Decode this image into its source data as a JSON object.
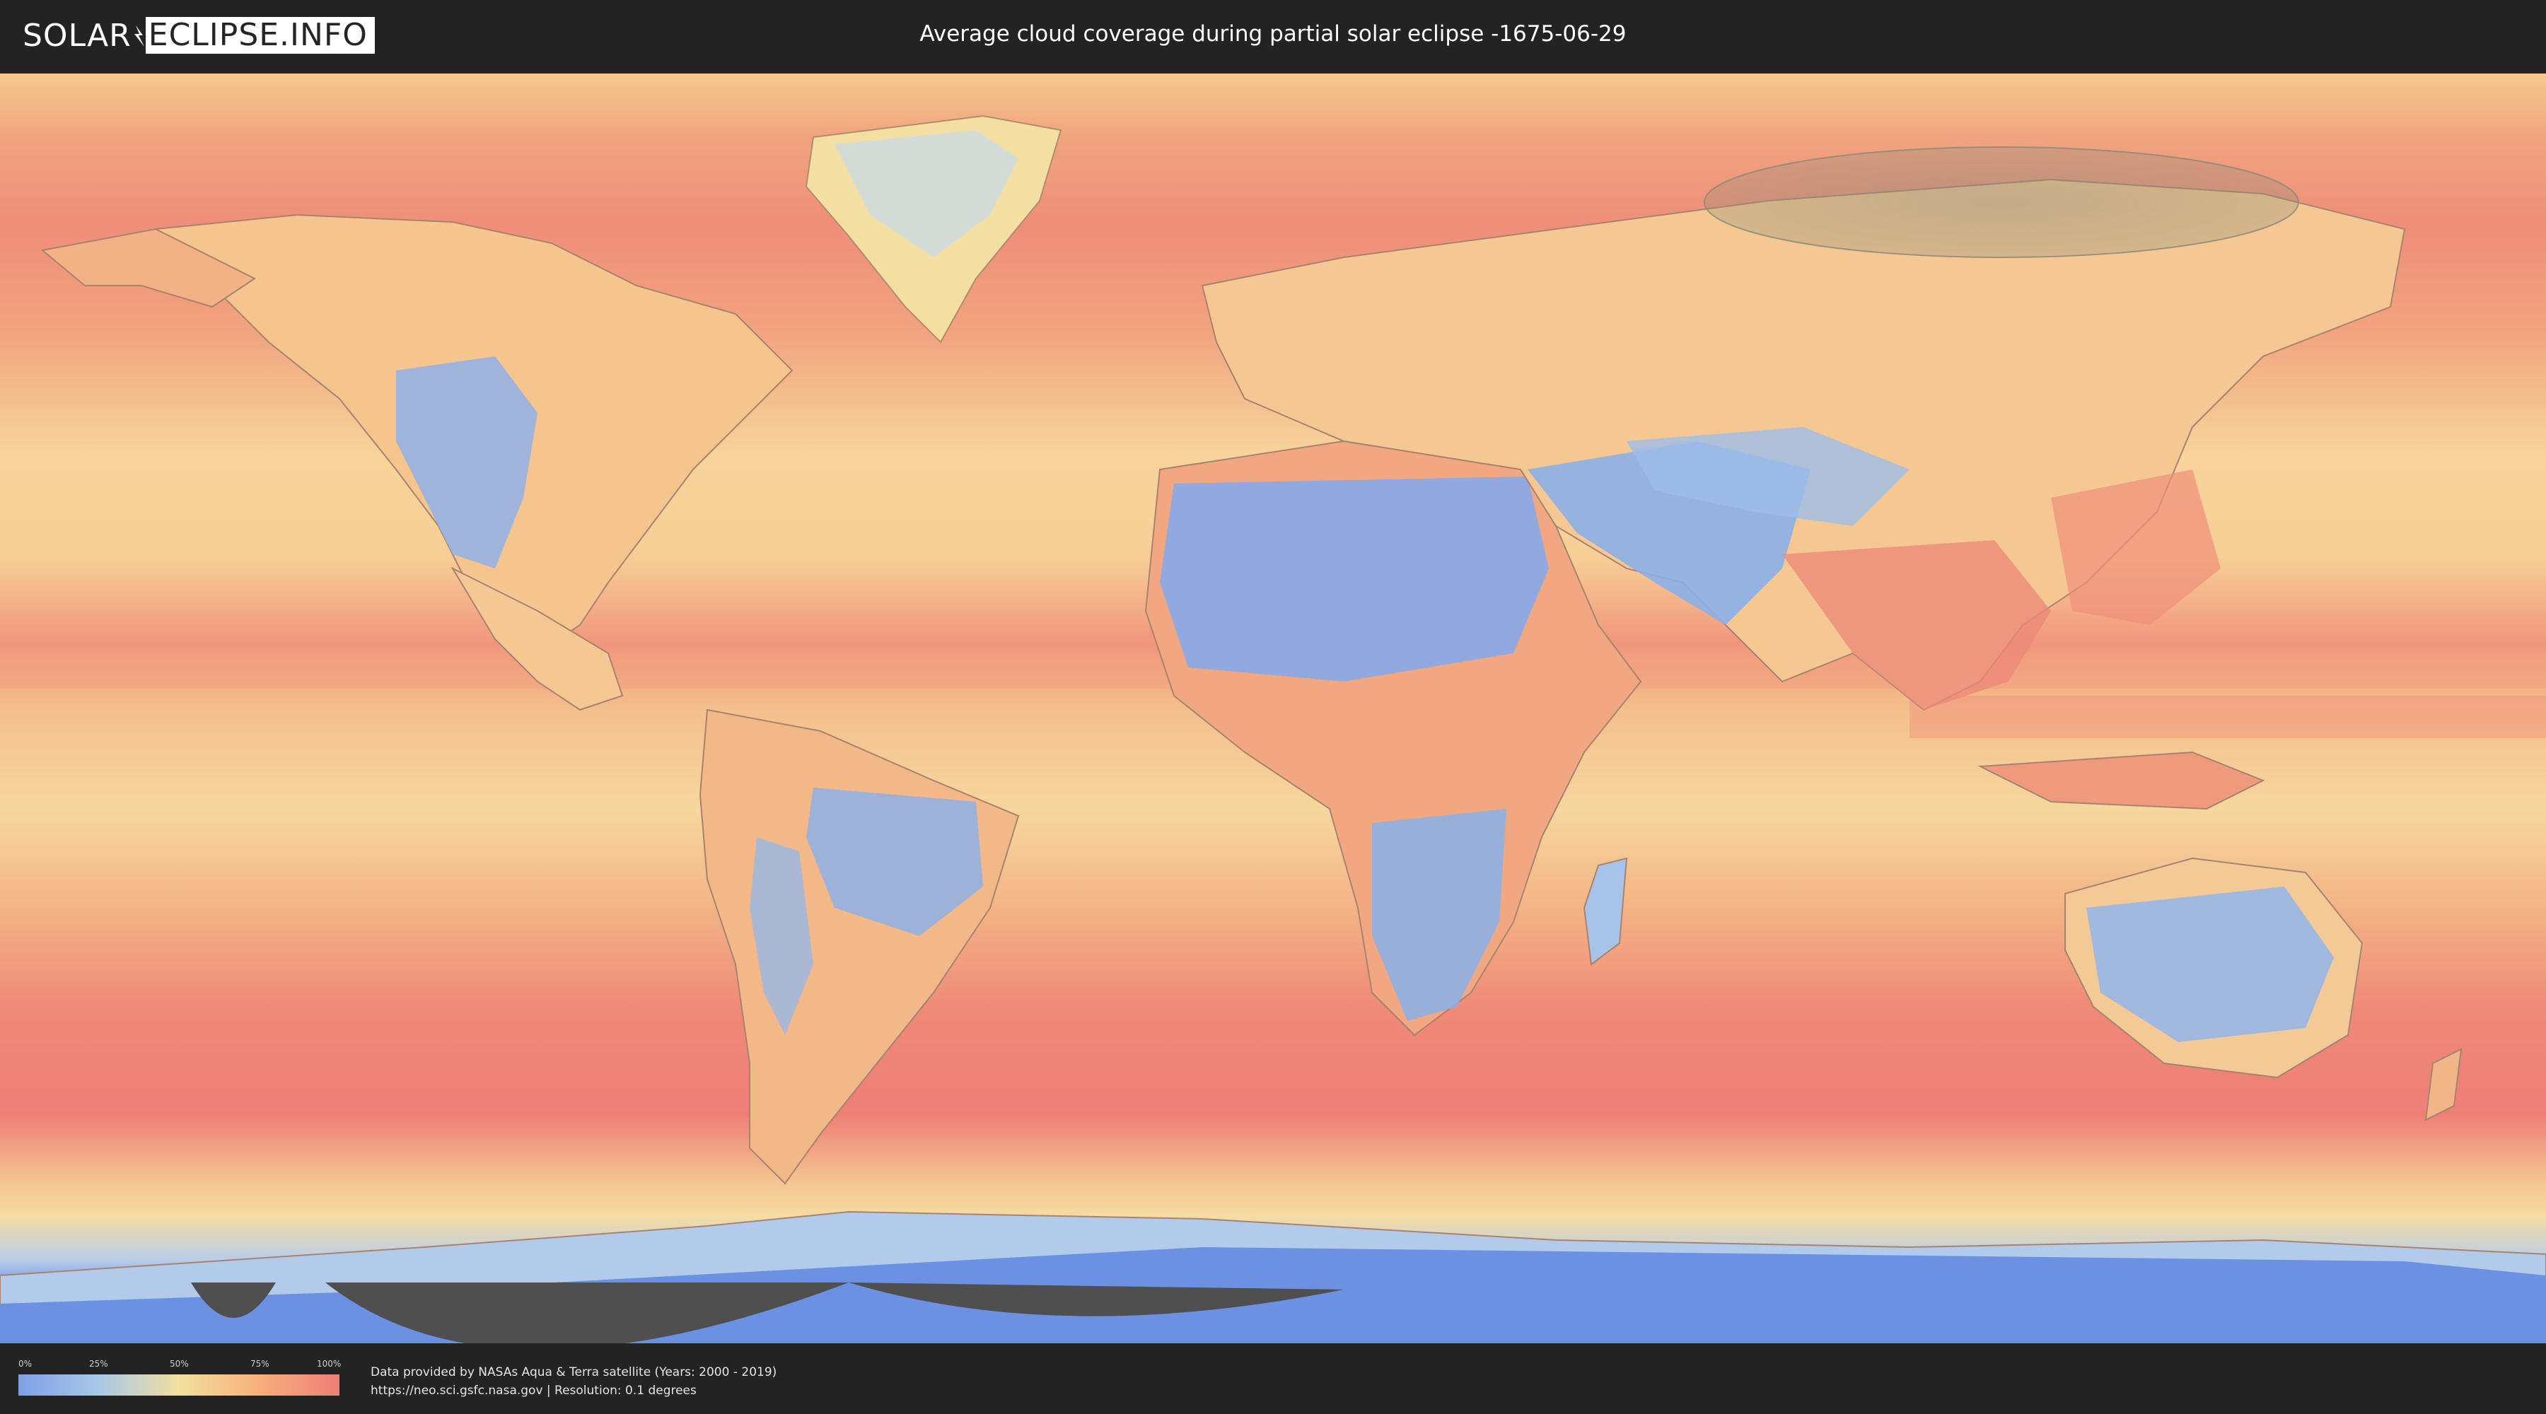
{
  "header": {
    "logo_left": "SOLAR",
    "logo_right": "ECLIPSE.INFO",
    "title": "Average cloud coverage during partial solar eclipse -1675-06-29"
  },
  "map": {
    "projection": "equirectangular",
    "layer": "average cloud coverage",
    "eclipse_region": "northern Siberia",
    "colors": {
      "clear": "#7fa3e8",
      "low": "#a8c8ea",
      "mid": "#f3e1a2",
      "high": "#f6ad7c",
      "full": "#ee7b77",
      "polar": "#5a7ee0",
      "shadow": "#8a8a7a"
    }
  },
  "legend": {
    "ticks": [
      "0%",
      "25%",
      "50%",
      "75%",
      "100%"
    ],
    "colors": [
      "#7e9fe6",
      "#a9c7e6",
      "#f1e0a0",
      "#f7b07d",
      "#ee7e78"
    ]
  },
  "credits": {
    "line1": "Data provided by NASAs Aqua & Terra satellite (Years: 2000 - 2019)",
    "line2": "https://neo.sci.gsfc.nasa.gov | Resolution: 0.1 degrees"
  }
}
